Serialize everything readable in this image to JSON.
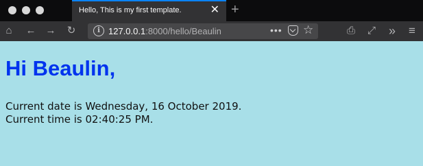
{
  "tab": {
    "title": "Hello, This is my first template.",
    "close": "✕"
  },
  "new_tab": "+",
  "nav": {
    "home": "⌂",
    "back": "←",
    "forward": "→",
    "reload": "↻",
    "print": "⎙",
    "fullscreen": "⤢",
    "more_tools": "»",
    "menu": "≡"
  },
  "url": {
    "info": "i",
    "host": "127.0.0.1",
    "rest": ":8000/hello/Beaulin",
    "more": "•••",
    "star": "☆"
  },
  "page": {
    "heading": "Hi Beaulin,",
    "date_line": "Current date is Wednesday, 16 October 2019.",
    "time_line": "Current time is 02:40:25 PM."
  },
  "colors": {
    "tab_accent": "#0a84ff",
    "page_bg": "#a8dfe8",
    "heading": "#0033ee"
  }
}
